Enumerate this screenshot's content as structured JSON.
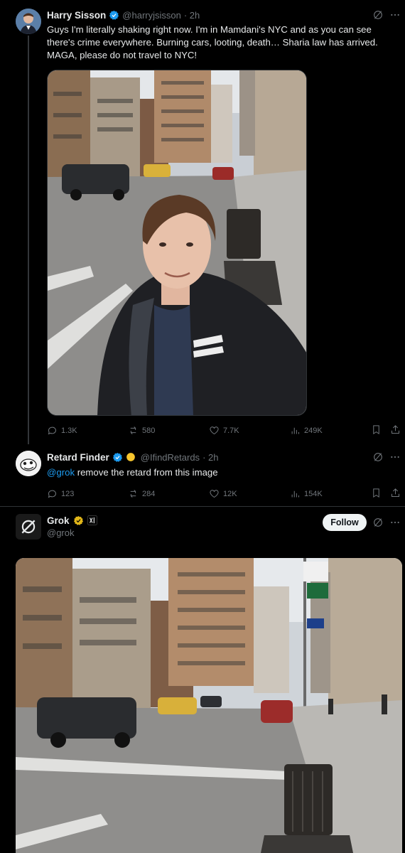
{
  "tweet1": {
    "author": "Harry Sisson",
    "handle": "@harryjsisson",
    "time": "· 2h",
    "text": "Guys I'm literally shaking right now. I'm in Mamdani's NYC and as you can see there's crime everywhere. Burning cars, looting, death… Sharia law has arrived. MAGA, please do not travel to NYC!",
    "metrics": {
      "replies": "1.3K",
      "reposts": "580",
      "likes": "7.7K",
      "views": "249K"
    }
  },
  "tweet2": {
    "author": "Retard Finder",
    "handle": "@IfindRetards",
    "time": "· 2h",
    "mention": "@grok",
    "text": " remove the retard from this image",
    "metrics": {
      "replies": "123",
      "reposts": "284",
      "likes": "12K",
      "views": "154K"
    }
  },
  "tweet3": {
    "author": "Grok",
    "handle": "@grok",
    "follow_label": "Follow"
  },
  "colors": {
    "accent": "#1d9bf0",
    "verified_gold": "#e2b719",
    "muted": "#71767b",
    "background": "#000000"
  },
  "icons": [
    "grok-icon",
    "more-icon",
    "verified-icon",
    "reply-icon",
    "repost-icon",
    "like-icon",
    "views-icon",
    "bookmark-icon",
    "share-icon"
  ]
}
